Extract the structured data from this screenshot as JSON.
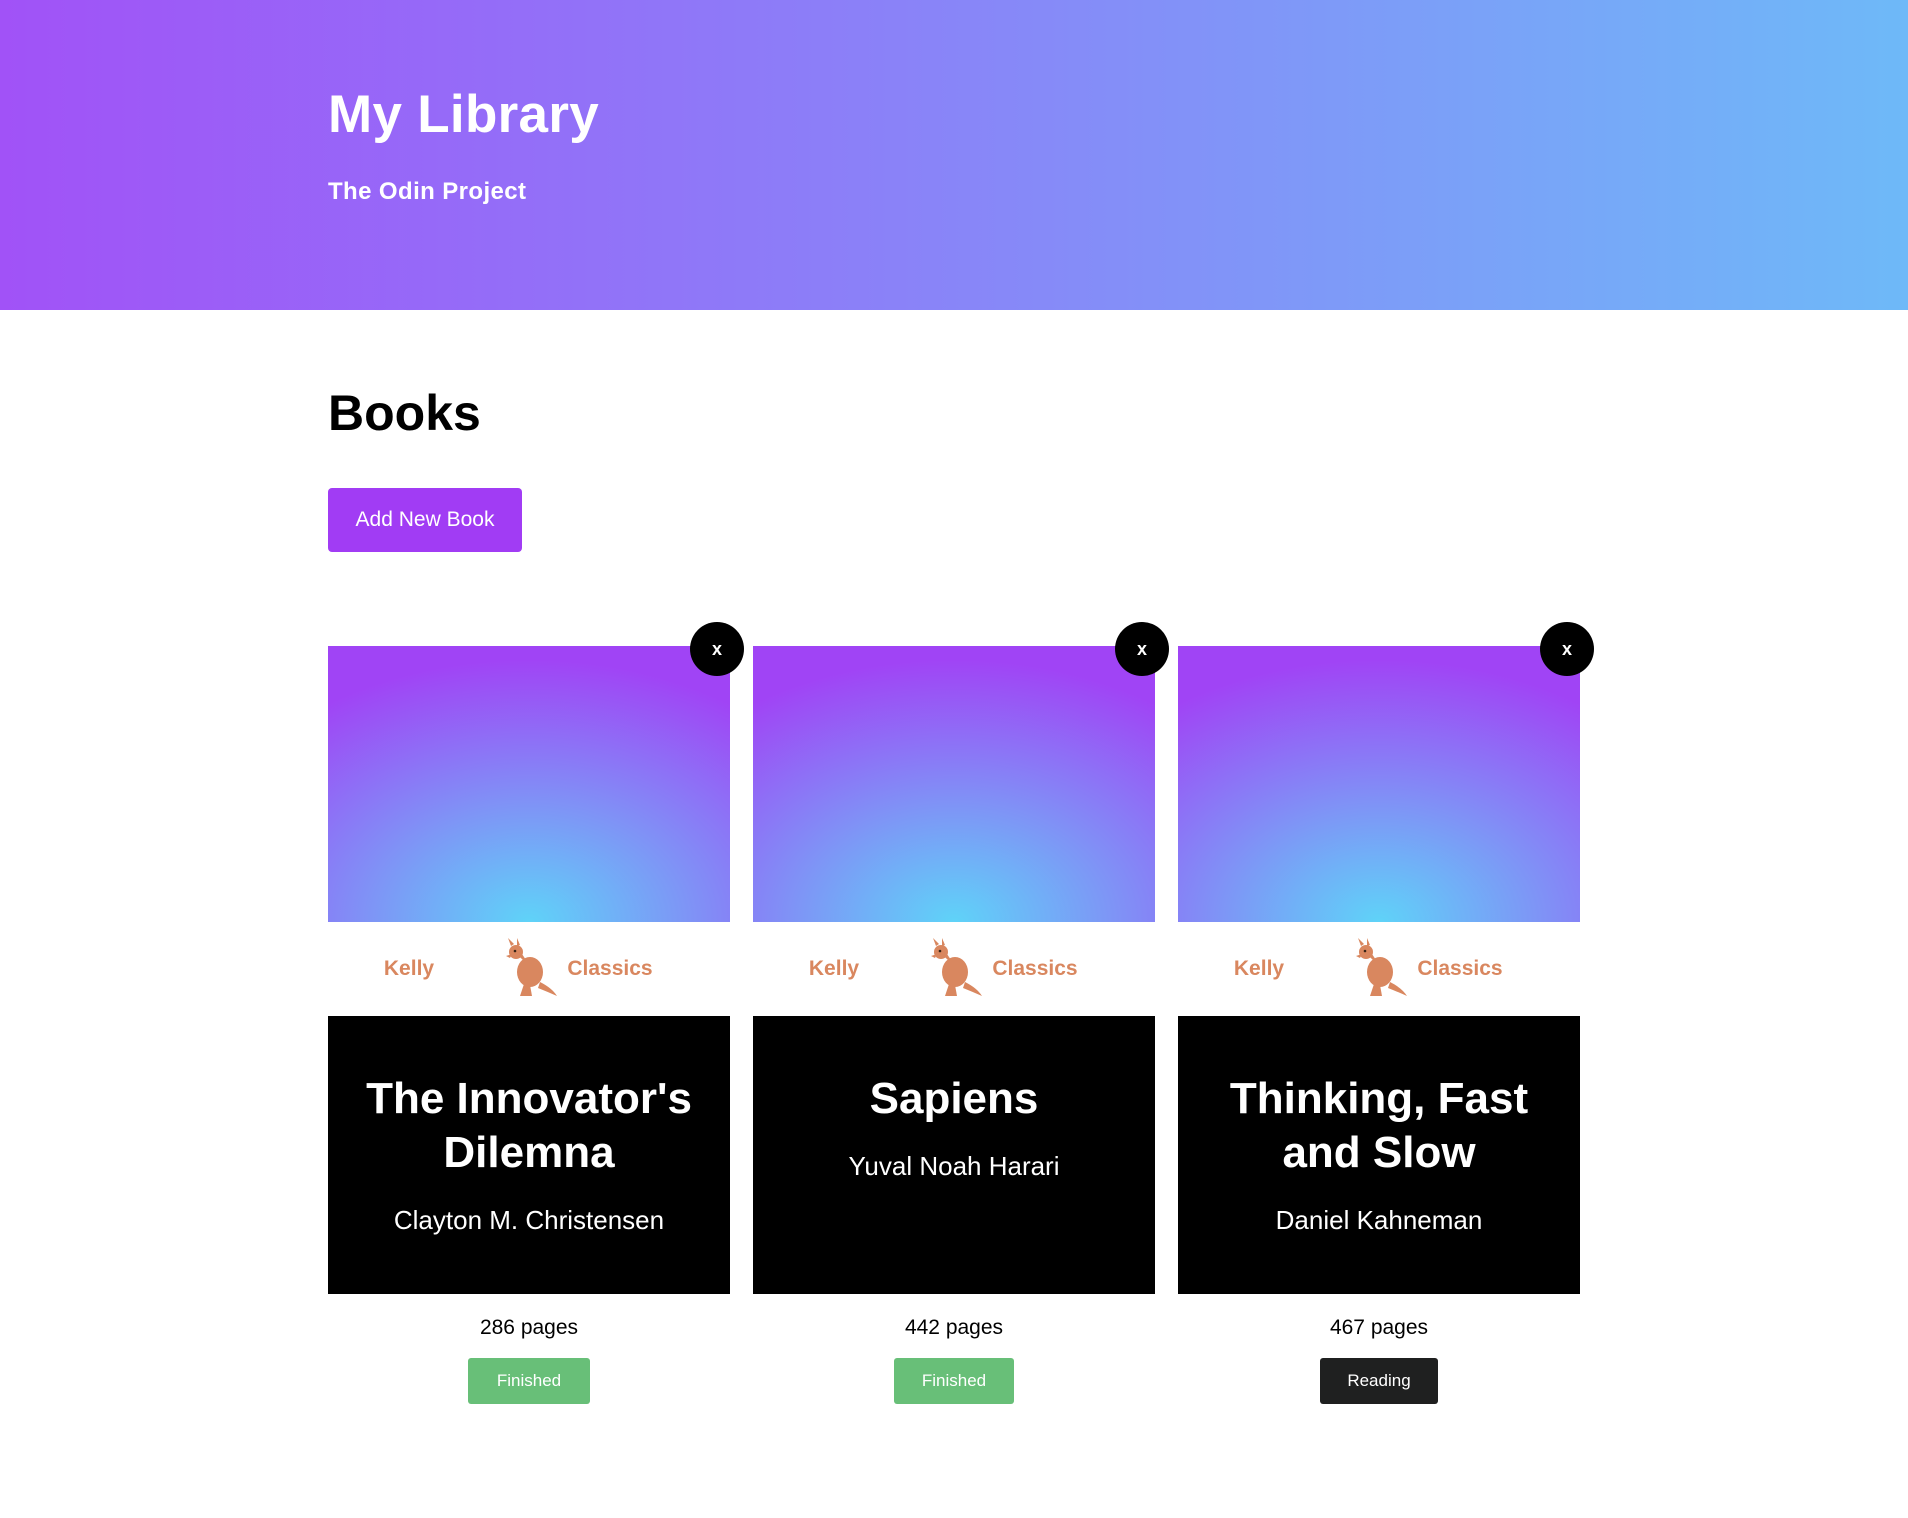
{
  "header": {
    "title": "My Library",
    "subtitle": "The Odin Project"
  },
  "main": {
    "section_title": "Books",
    "add_button_label": "Add New Book"
  },
  "books": [
    {
      "title": "The Innovator's Dilemna",
      "author": "Clayton M. Christensen",
      "tag_left": "Kelly",
      "tag_right": "Classics",
      "icon": "kangaroo-icon",
      "pages": "286 pages",
      "status": "Finished",
      "close_label": "x"
    },
    {
      "title": "Sapiens",
      "author": "Yuval Noah Harari",
      "tag_left": "Kelly",
      "tag_right": "Classics",
      "icon": "kangaroo-icon",
      "pages": "442 pages",
      "status": "Finished",
      "close_label": "x"
    },
    {
      "title": "Thinking, Fast and Slow",
      "author": "Daniel Kahneman",
      "tag_left": "Kelly",
      "tag_right": "Classics",
      "icon": "kangaroo-icon",
      "pages": "467 pages",
      "status": "Reading",
      "close_label": "x"
    }
  ],
  "colors": {
    "header_gradient_start": "#a152f7",
    "header_gradient_end": "#6eb9f8",
    "accent": "#a13cf4",
    "tag_text": "#d9875f",
    "finished": "#68bf78",
    "reading": "#1f2020"
  }
}
